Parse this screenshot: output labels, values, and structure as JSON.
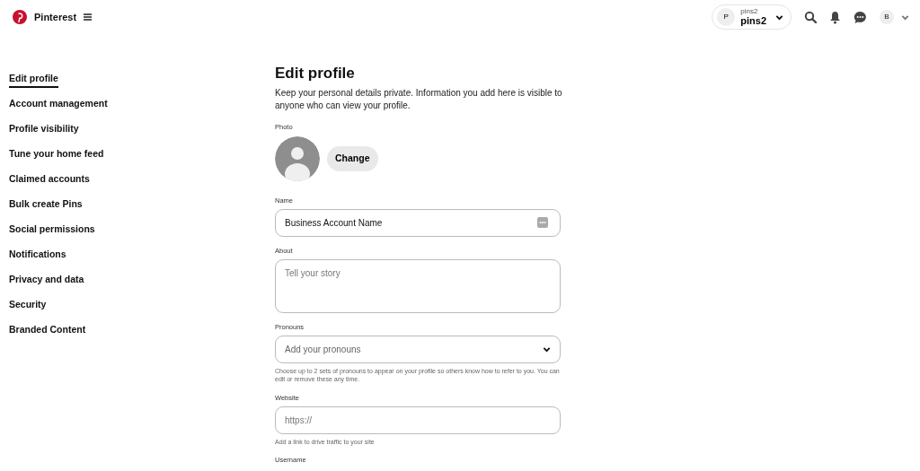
{
  "header": {
    "brand": "Pinterest",
    "account_switcher": {
      "initial": "P",
      "small_name": "pins2",
      "name": "pins2"
    },
    "user_initial": "B"
  },
  "sidebar": {
    "items": [
      {
        "label": "Edit profile",
        "selected": true
      },
      {
        "label": "Account management",
        "selected": false
      },
      {
        "label": "Profile visibility",
        "selected": false
      },
      {
        "label": "Tune your home feed",
        "selected": false
      },
      {
        "label": "Claimed accounts",
        "selected": false
      },
      {
        "label": "Bulk create Pins",
        "selected": false
      },
      {
        "label": "Social permissions",
        "selected": false
      },
      {
        "label": "Notifications",
        "selected": false
      },
      {
        "label": "Privacy and data",
        "selected": false
      },
      {
        "label": "Security",
        "selected": false
      },
      {
        "label": "Branded Content",
        "selected": false
      }
    ]
  },
  "main": {
    "title": "Edit profile",
    "intro": "Keep your personal details private. Information you add here is visible to anyone who can view your profile.",
    "photo": {
      "label": "Photo",
      "button": "Change"
    },
    "fields": [
      {
        "kind": "input",
        "label": "Name",
        "value": "Business Account Name",
        "autofill_icon": true
      },
      {
        "kind": "textarea",
        "label": "About",
        "placeholder": "Tell your story"
      },
      {
        "kind": "select",
        "label": "Pronouns",
        "placeholder": "Add your pronouns",
        "help": "Choose up to 2 sets of pronouns to appear on your profile so others know how to refer to you. You can edit or remove these any time."
      },
      {
        "kind": "input",
        "label": "Website",
        "placeholder": "https://",
        "help": "Add a link to drive traffic to your site"
      },
      {
        "kind": "cut",
        "label": "Username"
      }
    ]
  }
}
